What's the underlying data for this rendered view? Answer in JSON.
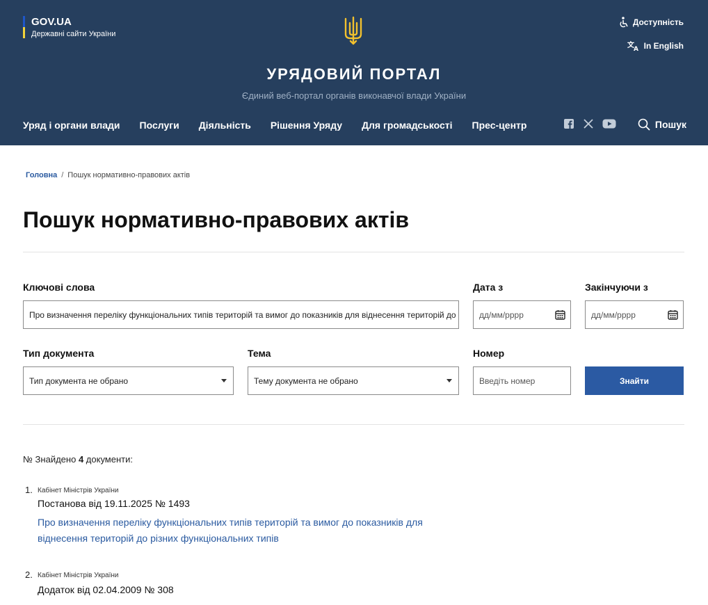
{
  "header": {
    "gov_title": "GOV.UA",
    "gov_subtitle": "Державні сайти України",
    "accessibility": "Доступність",
    "language": "In English",
    "portal_title": "УРЯДОВИЙ ПОРТАЛ",
    "portal_subtitle": "Єдиний веб-портал органів виконавчої влади України",
    "nav": [
      "Уряд і органи влади",
      "Послуги",
      "Діяльність",
      "Рішення Уряду",
      "Для громадськості",
      "Прес-центр"
    ],
    "search": "Пошук",
    "social_icons": [
      "facebook-icon",
      "x-icon",
      "youtube-icon"
    ]
  },
  "breadcrumb": {
    "home": "Головна",
    "separator": "/",
    "current": "Пошук нормативно-правових актів"
  },
  "page_title": "Пошук нормативно-правових актів",
  "form": {
    "keywords_label": "Ключові слова",
    "keywords_value": "Про визначення переліку функціональних типів територій та вимог до показників для віднесення територій до різних функціональних типів",
    "date_from_label": "Дата з",
    "date_from_placeholder": "дд/мм/рррр",
    "date_to_label": "Закінчуючи з",
    "date_to_placeholder": "дд/мм/рррр",
    "doc_type_label": "Тип документа",
    "doc_type_value": "Тип документа не обрано",
    "topic_label": "Тема",
    "topic_value": "Тему документа не обрано",
    "number_label": "Номер",
    "number_placeholder": "Введіть номер",
    "submit": "Знайти"
  },
  "results": {
    "found_prefix": "№ Знайдено",
    "found_count": "4",
    "found_suffix": "документи:",
    "items": [
      {
        "num": "1.",
        "org": "Кабінет Міністрів України",
        "doc": "Постанова від 19.11.2025 № 1493",
        "title": "Про визначення переліку функціональних типів територій та вимог до показників для віднесення територій до різних функціональних типів"
      },
      {
        "num": "2.",
        "org": "Кабінет Міністрів України",
        "doc": "Додаток від 02.04.2009 № 308"
      }
    ]
  },
  "colors": {
    "header_bg": "#263f5e",
    "accent": "#2b5aa3",
    "link": "#2a5aa0",
    "gold": "#f2d43a"
  }
}
